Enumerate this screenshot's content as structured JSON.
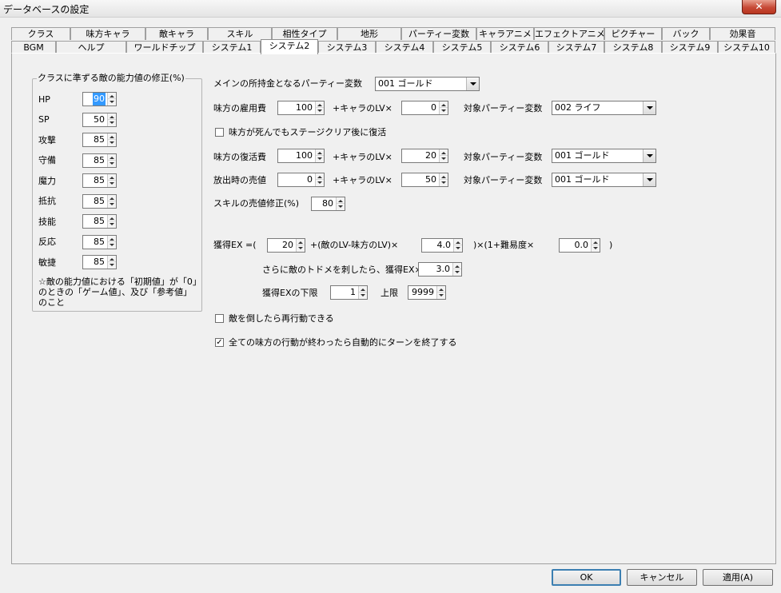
{
  "window": {
    "title": "データベースの設定",
    "close_label": "✕"
  },
  "tabs_row1": [
    "クラス",
    "味方キャラ",
    "敵キャラ",
    "スキル",
    "相性タイプ",
    "地形",
    "パーティー変数",
    "キャラアニメ",
    "エフェクトアニメ",
    "ピクチャー",
    "バック",
    "効果音"
  ],
  "tabs_row2": [
    "BGM",
    "ヘルプ",
    "ワールドチップ",
    "システム1",
    "システム2",
    "システム3",
    "システム4",
    "システム5",
    "システム6",
    "システム7",
    "システム8",
    "システム9",
    "システム10"
  ],
  "selected_tab": "システム2",
  "class_group": {
    "title": "クラスに準ずる敵の能力値の修正(%)",
    "stats": [
      {
        "label": "HP",
        "value": "90"
      },
      {
        "label": "SP",
        "value": "50"
      },
      {
        "label": "攻撃",
        "value": "85"
      },
      {
        "label": "守備",
        "value": "85"
      },
      {
        "label": "魔力",
        "value": "85"
      },
      {
        "label": "抵抗",
        "value": "85"
      },
      {
        "label": "技能",
        "value": "85"
      },
      {
        "label": "反応",
        "value": "85"
      },
      {
        "label": "敏捷",
        "value": "85"
      }
    ],
    "note": "☆敵の能力値における「初期値」が「0」のときの「ゲーム値」、及び「参考値」のこと"
  },
  "main_money": {
    "label": "メインの所持金となるパーティー変数",
    "value": "001 ゴールド"
  },
  "hire": {
    "label": "味方の雇用費",
    "base": "100",
    "plus_label": "+キャラのLV×",
    "per_lv": "0",
    "target_label": "対象パーティー変数",
    "target": "002 ライフ"
  },
  "revive_checkbox": {
    "label": "味方が死んでもステージクリア後に復活",
    "checked": false,
    "mark": ""
  },
  "revive": {
    "label": "味方の復活費",
    "base": "100",
    "plus_label": "+キャラのLV×",
    "per_lv": "20",
    "target_label": "対象パーティー変数",
    "target": "001 ゴールド"
  },
  "release": {
    "label": "放出時の売値",
    "base": "0",
    "plus_label": "+キャラのLV×",
    "per_lv": "50",
    "target_label": "対象パーティー変数",
    "target": "001 ゴールド"
  },
  "skill_sell": {
    "label": "スキルの売値修正(%)",
    "value": "80"
  },
  "exp": {
    "prefix": "獲得EX =(",
    "base": "20",
    "mid": "+(敵のLV-味方のLV)×",
    "factor": "4.0",
    "mid2": ")×(1+難易度×",
    "difficulty": "0.0",
    "suffix": ")",
    "finish_label": "さらに敵のトドメを刺したら、獲得EX×",
    "finish_value": "3.0",
    "min_label": "獲得EXの下限",
    "min_value": "1",
    "max_label": "上限",
    "max_value": "9999"
  },
  "reaction_checkbox": {
    "label": "敵を倒したら再行動できる",
    "checked": false,
    "mark": ""
  },
  "autoturn_checkbox": {
    "label": "全ての味方の行動が終わったら自動的にターンを終了する",
    "checked": true,
    "mark": "✓"
  },
  "buttons": {
    "ok": "OK",
    "cancel": "キャンセル",
    "apply": "適用(A)"
  }
}
